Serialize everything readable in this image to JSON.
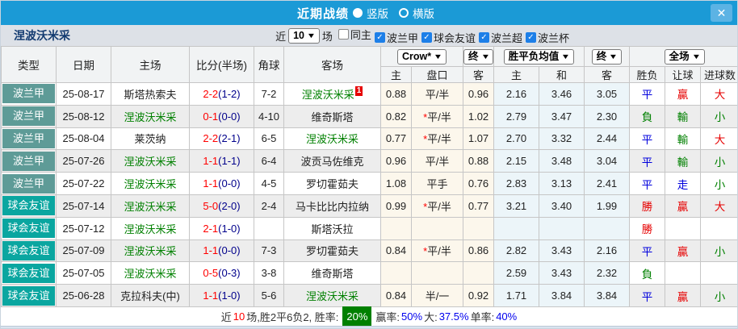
{
  "titlebar": {
    "title": "近期战绩",
    "radio_vertical": "竖版",
    "radio_horizontal": "横版",
    "close": "✕"
  },
  "filterbar": {
    "team": "涅波沃米采",
    "near_label": "近",
    "count": "10",
    "games_label": "场",
    "checkboxes": [
      {
        "label": "同主",
        "checked": false
      },
      {
        "label": "波兰甲",
        "checked": true
      },
      {
        "label": "球会友谊",
        "checked": true
      },
      {
        "label": "波兰超",
        "checked": true
      },
      {
        "label": "波兰杯",
        "checked": true
      }
    ]
  },
  "table": {
    "headers": {
      "type": "类型",
      "date": "日期",
      "home": "主场",
      "score": "比分(半场)",
      "corner": "角球",
      "away": "客场",
      "select_crow": "Crow*",
      "select_final1": "终",
      "select_avg": "胜平负均值",
      "select_final2": "终",
      "select_scope": "全场",
      "sub_home": "主",
      "sub_handicap": "盘口",
      "sub_away": "客",
      "sub_avg_home": "主",
      "sub_avg_draw": "和",
      "sub_avg_away": "客",
      "sub_result": "胜负",
      "sub_letgoal": "让球",
      "sub_goals": "进球数"
    },
    "league_colors": {
      "league": "#5e9b97",
      "friendly": "#0aa6a0"
    },
    "rows": [
      {
        "league": "波兰甲",
        "league_kind": "league",
        "date": "25-08-17",
        "home": "斯塔热索夫",
        "home_green": false,
        "ft": "2-2",
        "ht": "(1-2)",
        "corner": "7-2",
        "away": "涅波沃米采",
        "away_green": true,
        "away_badge": "1",
        "odds_h": "0.88",
        "pk_star": false,
        "pk": "平/半",
        "odds_a": "0.96",
        "avg_h": "2.16",
        "avg_d": "3.46",
        "avg_a": "3.05",
        "res": "平",
        "res_c": "b",
        "hres": "贏",
        "hres_c": "r",
        "goals": "大",
        "goals_c": "r"
      },
      {
        "league": "波兰甲",
        "league_kind": "league",
        "date": "25-08-12",
        "home": "涅波沃米采",
        "home_green": true,
        "ft": "0-1",
        "ht": "(0-0)",
        "corner": "4-10",
        "away": "维奇斯塔",
        "away_green": false,
        "away_badge": "",
        "odds_h": "0.82",
        "pk_star": true,
        "pk": "平/半",
        "odds_a": "1.02",
        "avg_h": "2.79",
        "avg_d": "3.47",
        "avg_a": "2.30",
        "res": "負",
        "res_c": "g",
        "hres": "輸",
        "hres_c": "g",
        "goals": "小",
        "goals_c": "g"
      },
      {
        "league": "波兰甲",
        "league_kind": "league",
        "date": "25-08-04",
        "home": "莱茨纳",
        "home_green": false,
        "ft": "2-2",
        "ht": "(2-1)",
        "corner": "6-5",
        "away": "涅波沃米采",
        "away_green": true,
        "away_badge": "",
        "odds_h": "0.77",
        "pk_star": true,
        "pk": "平/半",
        "odds_a": "1.07",
        "avg_h": "2.70",
        "avg_d": "3.32",
        "avg_a": "2.44",
        "res": "平",
        "res_c": "b",
        "hres": "輸",
        "hres_c": "g",
        "goals": "大",
        "goals_c": "r"
      },
      {
        "league": "波兰甲",
        "league_kind": "league",
        "date": "25-07-26",
        "home": "涅波沃米采",
        "home_green": true,
        "ft": "1-1",
        "ht": "(1-1)",
        "corner": "6-4",
        "away": "波贡马佐维克",
        "away_green": false,
        "away_badge": "",
        "odds_h": "0.96",
        "pk_star": false,
        "pk": "平/半",
        "odds_a": "0.88",
        "avg_h": "2.15",
        "avg_d": "3.48",
        "avg_a": "3.04",
        "res": "平",
        "res_c": "b",
        "hres": "輸",
        "hres_c": "g",
        "goals": "小",
        "goals_c": "g"
      },
      {
        "league": "波兰甲",
        "league_kind": "league",
        "date": "25-07-22",
        "home": "涅波沃米采",
        "home_green": true,
        "ft": "1-1",
        "ht": "(0-0)",
        "corner": "4-5",
        "away": "罗切霍茹夫",
        "away_green": false,
        "away_badge": "",
        "odds_h": "1.08",
        "pk_star": false,
        "pk": "平手",
        "odds_a": "0.76",
        "avg_h": "2.83",
        "avg_d": "3.13",
        "avg_a": "2.41",
        "res": "平",
        "res_c": "b",
        "hres": "走",
        "hres_c": "b",
        "goals": "小",
        "goals_c": "g"
      },
      {
        "league": "球会友谊",
        "league_kind": "friendly",
        "date": "25-07-14",
        "home": "涅波沃米采",
        "home_green": true,
        "ft": "5-0",
        "ht": "(2-0)",
        "corner": "2-4",
        "away": "马卡比比内拉纳",
        "away_green": false,
        "away_badge": "",
        "odds_h": "0.99",
        "pk_star": true,
        "pk": "平/半",
        "odds_a": "0.77",
        "avg_h": "3.21",
        "avg_d": "3.40",
        "avg_a": "1.99",
        "res": "勝",
        "res_c": "r",
        "hres": "贏",
        "hres_c": "r",
        "goals": "大",
        "goals_c": "r"
      },
      {
        "league": "球会友谊",
        "league_kind": "friendly",
        "date": "25-07-12",
        "home": "涅波沃米采",
        "home_green": true,
        "ft": "2-1",
        "ht": "(1-0)",
        "corner": "",
        "away": "斯塔沃拉",
        "away_green": false,
        "away_badge": "",
        "odds_h": "",
        "pk_star": false,
        "pk": "",
        "odds_a": "",
        "avg_h": "",
        "avg_d": "",
        "avg_a": "",
        "res": "勝",
        "res_c": "r",
        "hres": "",
        "hres_c": "",
        "goals": "",
        "goals_c": ""
      },
      {
        "league": "球会友谊",
        "league_kind": "friendly",
        "date": "25-07-09",
        "home": "涅波沃米采",
        "home_green": true,
        "ft": "1-1",
        "ht": "(0-0)",
        "corner": "7-3",
        "away": "罗切霍茹夫",
        "away_green": false,
        "away_badge": "",
        "odds_h": "0.84",
        "pk_star": true,
        "pk": "平/半",
        "odds_a": "0.86",
        "avg_h": "2.82",
        "avg_d": "3.43",
        "avg_a": "2.16",
        "res": "平",
        "res_c": "b",
        "hres": "贏",
        "hres_c": "r",
        "goals": "小",
        "goals_c": "g"
      },
      {
        "league": "球会友谊",
        "league_kind": "friendly",
        "date": "25-07-05",
        "home": "涅波沃米采",
        "home_green": true,
        "ft": "0-5",
        "ht": "(0-3)",
        "corner": "3-8",
        "away": "维奇斯塔",
        "away_green": false,
        "away_badge": "",
        "odds_h": "",
        "pk_star": false,
        "pk": "",
        "odds_a": "",
        "avg_h": "2.59",
        "avg_d": "3.43",
        "avg_a": "2.32",
        "res": "負",
        "res_c": "g",
        "hres": "",
        "hres_c": "",
        "goals": "",
        "goals_c": ""
      },
      {
        "league": "球会友谊",
        "league_kind": "friendly",
        "date": "25-06-28",
        "home": "克拉科夫(中)",
        "home_green": false,
        "ft": "1-1",
        "ht": "(1-0)",
        "corner": "5-6",
        "away": "涅波沃米采",
        "away_green": true,
        "away_badge": "",
        "odds_h": "0.84",
        "pk_star": false,
        "pk": "半/一",
        "odds_a": "0.92",
        "avg_h": "1.71",
        "avg_d": "3.84",
        "avg_a": "3.84",
        "res": "平",
        "res_c": "b",
        "hres": "贏",
        "hres_c": "r",
        "goals": "小",
        "goals_c": "g"
      }
    ]
  },
  "summary": {
    "segments": [
      {
        "t": "近",
        "s": "plain"
      },
      {
        "t": "10",
        "s": "red"
      },
      {
        "t": "场,胜2平6负2, 胜率:",
        "s": "plain"
      },
      {
        "t": "20%",
        "s": "badge"
      },
      {
        "t": "赢率:",
        "s": "plain"
      },
      {
        "t": "50%",
        "s": "blue"
      },
      {
        "t": "大:",
        "s": "plain"
      },
      {
        "t": "37.5%",
        "s": "blue"
      },
      {
        "t": "单率:",
        "s": "plain"
      },
      {
        "t": "40%",
        "s": "blue"
      }
    ]
  }
}
